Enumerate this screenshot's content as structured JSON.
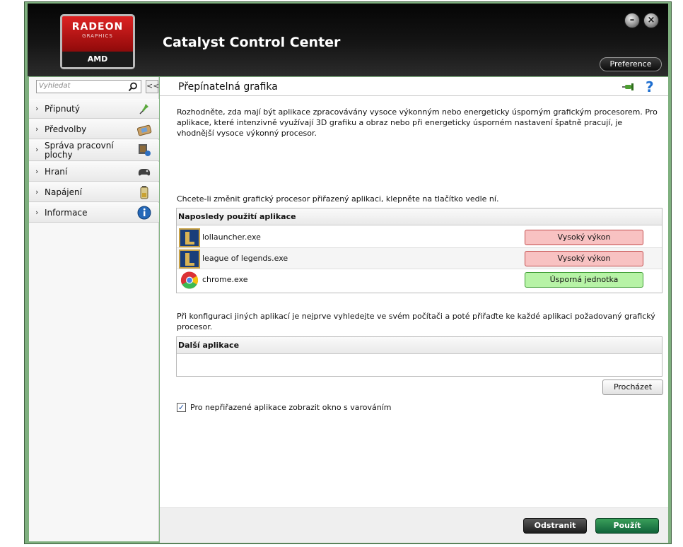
{
  "header": {
    "logo_line1": "RADEON",
    "logo_line2": "GRAPHICS",
    "logo_brand": "AMD",
    "app_title": "Catalyst Control Center",
    "preference_label": "Preference",
    "minimize_glyph": "–",
    "close_glyph": "×"
  },
  "sidebar": {
    "search_placeholder": "Vyhledat",
    "collapse_glyph": "<<",
    "items": [
      {
        "label": "Připnutý",
        "icon": "pin-icon"
      },
      {
        "label": "Předvolby",
        "icon": "presets-icon"
      },
      {
        "label": "Správa pracovní plochy",
        "icon": "desktop-management-icon"
      },
      {
        "label": "Hraní",
        "icon": "gamepad-icon"
      },
      {
        "label": "Napájení",
        "icon": "battery-icon"
      },
      {
        "label": "Informace",
        "icon": "info-icon"
      }
    ]
  },
  "main": {
    "title": "Přepínatelná grafika",
    "intro": "Rozhodněte, zda mají být aplikace zpracovávány vysoce výkonným nebo energeticky úsporným grafickým procesorem. Pro aplikace, které intenzivně využívají 3D grafiku a obraz nebo při energeticky úsporném nastavení špatně pracují, je vhodnější vysoce výkonný procesor.",
    "choose_text": "Chcete-li změnit grafický procesor přiřazený aplikaci, klepněte na tlačítko vedle ní.",
    "recent_header": "Naposledy použití aplikace",
    "recent_apps": [
      {
        "name": "lollauncher.exe",
        "gpu": "Vysoký výkon",
        "icon": "league-of-legends-icon"
      },
      {
        "name": "league of legends.exe",
        "gpu": "Vysoký výkon",
        "icon": "league-of-legends-icon"
      },
      {
        "name": "chrome.exe",
        "gpu": "Úsporná jednotka",
        "icon": "chrome-icon"
      }
    ],
    "config_text": "Při konfiguraci jiných aplikací je nejprve vyhledejte ve svém počítači a poté přiřaďte ke každé aplikaci požadovaný grafický procesor.",
    "other_header": "Další aplikace",
    "browse_label": "Procházet",
    "warn_checked": true,
    "warn_label": "Pro nepřiřazené aplikace zobrazit okno s varováním"
  },
  "footer": {
    "remove_label": "Odstranit",
    "apply_label": "Použít"
  },
  "colors": {
    "high_performance": "#f8c2c2",
    "power_saving": "#b7f3a6",
    "apply": "#1f7f45"
  }
}
